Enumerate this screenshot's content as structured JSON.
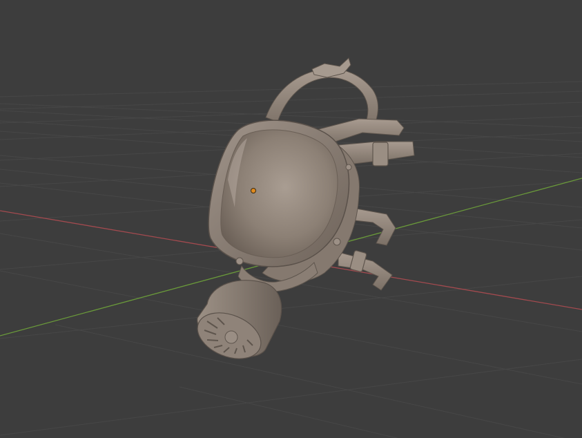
{
  "viewport": {
    "background_color": "#3d3d3d",
    "grid_color": "#4a4a4a",
    "x_axis_color": "#a34a4f",
    "y_axis_color": "#6a9a3a",
    "model_base_color": "#8f8276",
    "origin_dot_color": "#e08a1e"
  },
  "scene": {
    "object": "gas mask",
    "shading": "solid",
    "has_origin_marker": true
  }
}
